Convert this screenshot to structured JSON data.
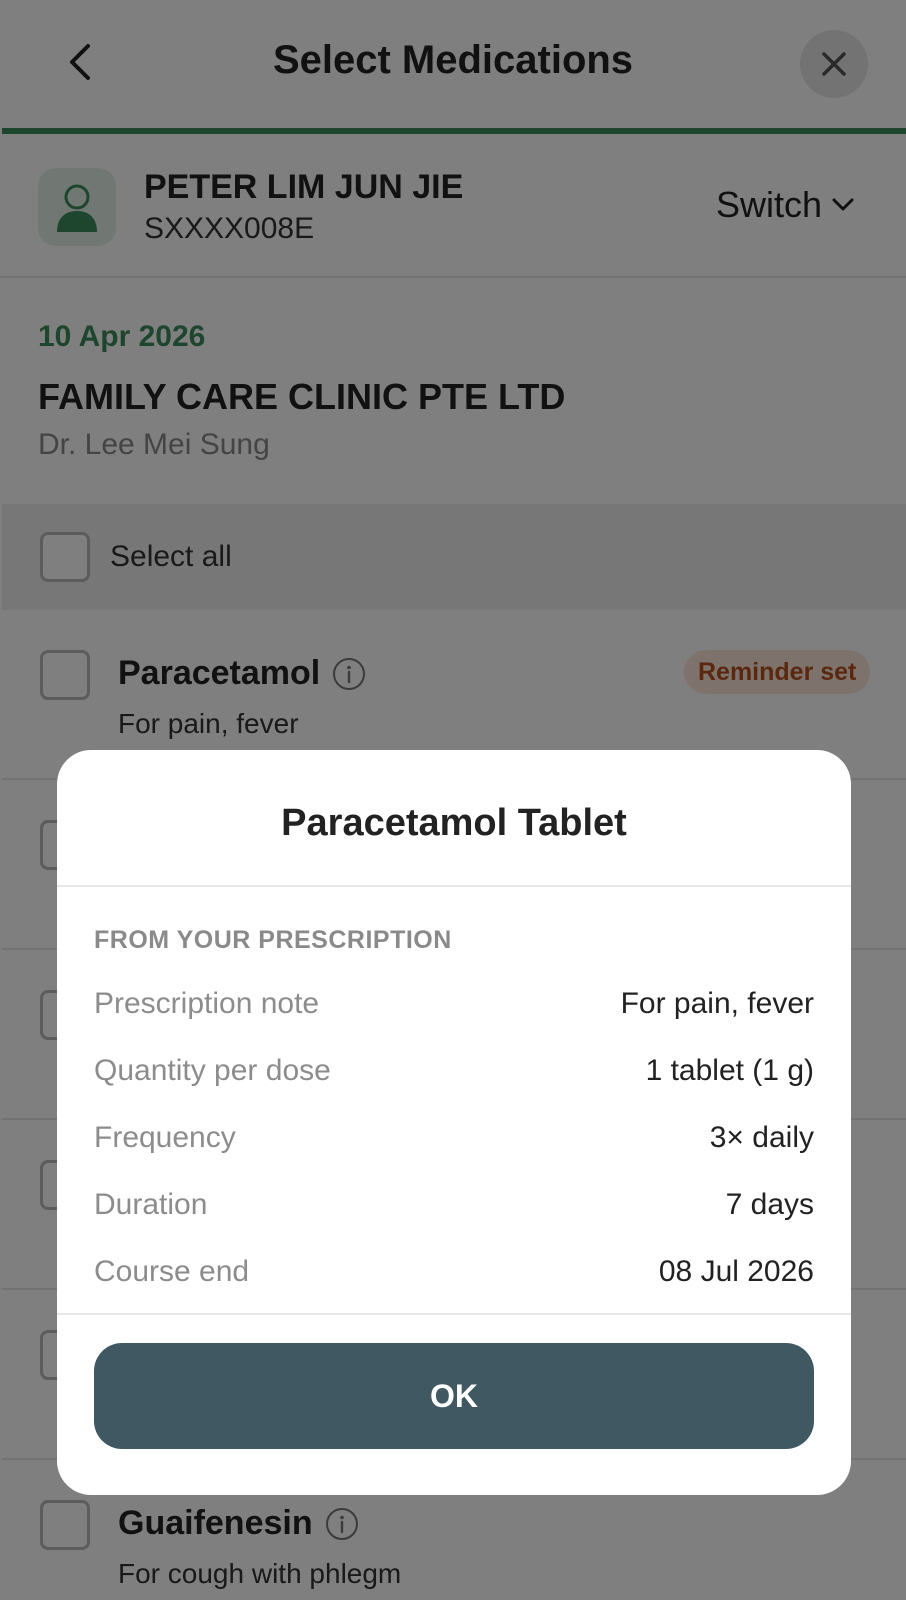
{
  "header": {
    "title": "Select Medications",
    "back_icon": "chevron-left-icon",
    "close_icon": "close-icon",
    "accent_color": "#3d8a5a"
  },
  "patient": {
    "name": "PETER LIM JUN JIE",
    "id": "SXXXX008E",
    "switch_label": "Switch",
    "avatar_icon": "user-icon"
  },
  "visit": {
    "date": "10 Apr 2026",
    "clinic": "FAMILY CARE CLINIC PTE LTD",
    "doctor": "Dr. Lee Mei Sung"
  },
  "select_all_label": "Select all",
  "medications": [
    {
      "name": "Paracetamol",
      "note": "For pain, fever",
      "badge": "Reminder set"
    },
    {
      "name": "Guaifenesin",
      "note": "For cough with phlegm",
      "badge": ""
    }
  ],
  "modal": {
    "title": "Paracetamol Tablet",
    "section_heading": "FROM YOUR PRESCRIPTION",
    "details": [
      {
        "label": "Prescription note",
        "value": "For pain, fever"
      },
      {
        "label": "Quantity per dose",
        "value": "1 tablet (1 g)"
      },
      {
        "label": "Frequency",
        "value": "3× daily"
      },
      {
        "label": "Duration",
        "value": "7 days"
      },
      {
        "label": "Course end",
        "value": "08 Jul 2026"
      }
    ],
    "ok_label": "OK",
    "button_color": "#405862"
  },
  "colors": {
    "badge_bg": "#fbe7d9",
    "badge_text": "#b5501e"
  }
}
